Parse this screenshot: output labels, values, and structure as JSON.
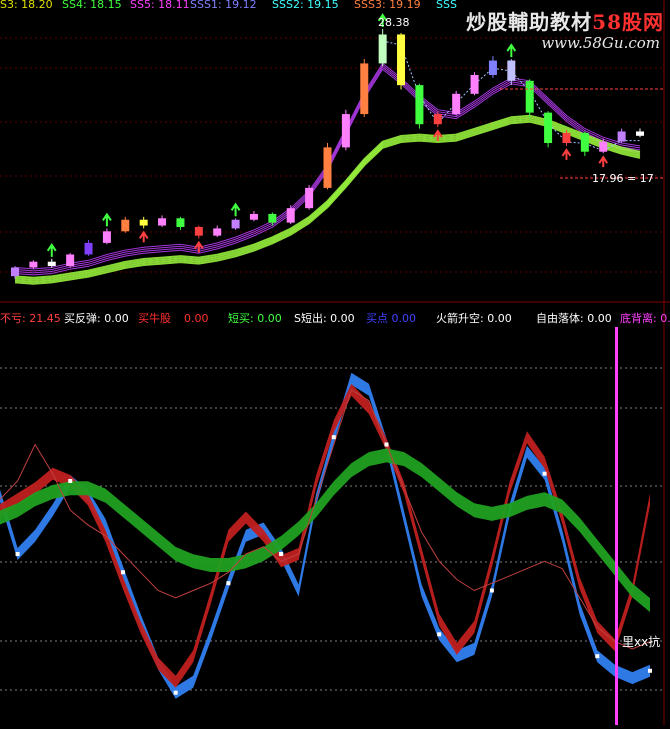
{
  "watermark": {
    "title_main": "炒股輔助教材",
    "title_red": "58股网",
    "url": "www.58Gu.com"
  },
  "top_legend": [
    {
      "text": "S3: 18.20",
      "color": "#e0e000"
    },
    {
      "text": "SS4: 18.15",
      "color": "#40ff40"
    },
    {
      "text": "SS5: 18.11",
      "color": "#ff40ff"
    },
    {
      "text": "SSS1: 19.12",
      "color": "#8080ff"
    },
    {
      "text": "SSS2: 19.15",
      "color": "#40ffff"
    },
    {
      "text": "SSS3: 19.19",
      "color": "#ff8040"
    },
    {
      "text": "SSS",
      "color": "#40ffff"
    }
  ],
  "annotations": {
    "peak_price": "28.38",
    "current_price": "17.96",
    "current_price_tail": "17",
    "bottom_marker": "里xx抗"
  },
  "indicator_legend": [
    {
      "text": "不亏: 21.45",
      "color": "#ff4040"
    },
    {
      "text": "买反弹: 0.00",
      "color": "#ffffff"
    },
    {
      "text": "买牛股",
      "color": "#ff3030"
    },
    {
      "text": "0.00",
      "color": "#ff3030"
    },
    {
      "text": "短买: 0.00",
      "color": "#40ff40"
    },
    {
      "text": "S短出: 0.00",
      "color": "#ffffff"
    },
    {
      "text": "买点 0.00",
      "color": "#4040ff"
    },
    {
      "text": "火箭升空: 0.00",
      "color": "#ffffff"
    },
    {
      "text": "自由落体: 0.00",
      "color": "#ffffff"
    },
    {
      "text": "底背离: 0.00",
      "color": "#ff40ff"
    }
  ],
  "chart_data": [
    {
      "type": "candlestick",
      "title": "",
      "series": [
        {
          "name": "SS5",
          "values": [
            11.9,
            11.8,
            11.9,
            12.2,
            12.4,
            12.8,
            13.1,
            13.3,
            13.4,
            13.5,
            13.3,
            13.6,
            14.0,
            14.5,
            15.1,
            16.0,
            17.2,
            19.0,
            21.5,
            24.0,
            26.0,
            25.0,
            23.8,
            22.8,
            22.6,
            23.4,
            24.3,
            25.0,
            24.8,
            23.6,
            22.4,
            21.5,
            20.9,
            20.5,
            20.3
          ]
        },
        {
          "name": "SSS1",
          "values": [
            11.7,
            11.6,
            11.7,
            11.9,
            12.1,
            12.4,
            12.7,
            12.9,
            13.0,
            13.1,
            13.0,
            13.2,
            13.5,
            13.9,
            14.4,
            15.0,
            15.8,
            16.9,
            18.3,
            19.8,
            21.0,
            21.4,
            21.5,
            21.4,
            21.5,
            21.9,
            22.3,
            22.7,
            22.8,
            22.5,
            22.0,
            21.5,
            21.0,
            20.6,
            20.3
          ]
        }
      ],
      "labels": {
        "peak": "28.38",
        "last": "17.96"
      },
      "candles": [
        {
          "c": "#c080ff",
          "o": 11.3,
          "cl": 11.9,
          "h": 12.0,
          "l": 11.1
        },
        {
          "c": "#ff80ff",
          "o": 11.9,
          "cl": 12.3,
          "h": 12.4,
          "l": 11.8
        },
        {
          "c": "#ffffff",
          "o": 12.3,
          "cl": 12.0,
          "h": 12.5,
          "l": 11.9
        },
        {
          "c": "#ff80ff",
          "o": 12.0,
          "cl": 12.8,
          "h": 12.9,
          "l": 11.9
        },
        {
          "c": "#8040ff",
          "o": 12.8,
          "cl": 13.6,
          "h": 13.8,
          "l": 12.7
        },
        {
          "c": "#ff80ff",
          "o": 13.6,
          "cl": 14.4,
          "h": 14.6,
          "l": 13.5
        },
        {
          "c": "#ff8040",
          "o": 14.4,
          "cl": 15.2,
          "h": 15.4,
          "l": 14.3
        },
        {
          "c": "#ffff40",
          "o": 15.2,
          "cl": 14.8,
          "h": 15.4,
          "l": 14.6
        },
        {
          "c": "#ff80ff",
          "o": 14.8,
          "cl": 15.3,
          "h": 15.5,
          "l": 14.7
        },
        {
          "c": "#40ff40",
          "o": 15.3,
          "cl": 14.7,
          "h": 15.4,
          "l": 14.5
        },
        {
          "c": "#ff4040",
          "o": 14.7,
          "cl": 14.1,
          "h": 14.8,
          "l": 13.9
        },
        {
          "c": "#ff80ff",
          "o": 14.1,
          "cl": 14.6,
          "h": 14.8,
          "l": 14.0
        },
        {
          "c": "#c080ff",
          "o": 14.6,
          "cl": 15.2,
          "h": 15.3,
          "l": 14.5
        },
        {
          "c": "#ff80ff",
          "o": 15.2,
          "cl": 15.6,
          "h": 15.8,
          "l": 15.1
        },
        {
          "c": "#40ff40",
          "o": 15.6,
          "cl": 15.0,
          "h": 15.7,
          "l": 14.8
        },
        {
          "c": "#ff80ff",
          "o": 15.0,
          "cl": 16.0,
          "h": 16.2,
          "l": 14.9
        },
        {
          "c": "#ff80ff",
          "o": 16.0,
          "cl": 17.4,
          "h": 17.6,
          "l": 15.9
        },
        {
          "c": "#ff8040",
          "o": 17.4,
          "cl": 20.2,
          "h": 20.5,
          "l": 17.3
        },
        {
          "c": "#ff80ff",
          "o": 20.2,
          "cl": 22.5,
          "h": 22.8,
          "l": 20.0
        },
        {
          "c": "#ff8040",
          "o": 22.5,
          "cl": 26.0,
          "h": 26.3,
          "l": 22.3
        },
        {
          "c": "#c0ffc0",
          "o": 26.0,
          "cl": 28.0,
          "h": 28.38,
          "l": 25.8
        },
        {
          "c": "#ffff40",
          "o": 28.0,
          "cl": 24.5,
          "h": 28.1,
          "l": 24.2
        },
        {
          "c": "#40ff40",
          "o": 24.5,
          "cl": 21.8,
          "h": 24.6,
          "l": 21.5
        },
        {
          "c": "#ff4040",
          "o": 21.8,
          "cl": 22.5,
          "h": 22.7,
          "l": 21.6
        },
        {
          "c": "#ff80ff",
          "o": 22.5,
          "cl": 23.9,
          "h": 24.1,
          "l": 22.4
        },
        {
          "c": "#ff80ff",
          "o": 23.9,
          "cl": 25.2,
          "h": 25.4,
          "l": 23.8
        },
        {
          "c": "#8080ff",
          "o": 25.2,
          "cl": 26.2,
          "h": 26.5,
          "l": 25.0
        },
        {
          "c": "#c0c0ff",
          "o": 26.2,
          "cl": 24.8,
          "h": 26.3,
          "l": 24.5
        },
        {
          "c": "#40ff40",
          "o": 24.8,
          "cl": 22.6,
          "h": 24.9,
          "l": 22.3
        },
        {
          "c": "#40ff40",
          "o": 22.6,
          "cl": 20.5,
          "h": 22.7,
          "l": 20.2
        },
        {
          "c": "#ff4040",
          "o": 20.5,
          "cl": 21.2,
          "h": 21.4,
          "l": 20.3
        },
        {
          "c": "#40ff40",
          "o": 21.2,
          "cl": 19.9,
          "h": 21.3,
          "l": 19.6
        },
        {
          "c": "#ff80ff",
          "o": 19.9,
          "cl": 20.6,
          "h": 20.8,
          "l": 19.8
        },
        {
          "c": "#c080ff",
          "o": 20.6,
          "cl": 21.3,
          "h": 21.5,
          "l": 20.5
        },
        {
          "c": "#ffffff",
          "o": 21.3,
          "cl": 21.0,
          "h": 21.5,
          "l": 20.9
        }
      ]
    },
    {
      "type": "line",
      "title": "",
      "series": [
        {
          "name": "blue",
          "values": [
            56,
            40,
            45,
            52,
            60,
            56,
            48,
            35,
            22,
            10,
            2,
            5,
            18,
            32,
            45,
            47,
            40,
            30,
            55,
            72,
            88,
            85,
            70,
            50,
            30,
            18,
            12,
            14,
            30,
            52,
            68,
            62,
            45,
            25,
            12,
            8,
            6,
            8
          ]
        },
        {
          "name": "red",
          "values": [
            52,
            55,
            58,
            62,
            60,
            55,
            45,
            32,
            20,
            10,
            5,
            12,
            28,
            45,
            50,
            45,
            38,
            40,
            60,
            75,
            85,
            80,
            70,
            58,
            40,
            22,
            14,
            20,
            38,
            58,
            72,
            65,
            50,
            32,
            20,
            15,
            30,
            55
          ]
        },
        {
          "name": "green",
          "values": [
            50,
            52,
            55,
            57,
            58,
            58,
            56,
            52,
            48,
            44,
            40,
            38,
            37,
            37,
            38,
            40,
            43,
            47,
            52,
            58,
            63,
            66,
            67,
            66,
            63,
            59,
            55,
            52,
            51,
            52,
            54,
            55,
            53,
            48,
            42,
            36,
            30,
            26
          ]
        },
        {
          "name": "thin",
          "values": [
            55,
            60,
            70,
            62,
            52,
            48,
            45,
            40,
            35,
            30,
            28,
            30,
            32,
            35,
            40,
            42,
            38,
            40,
            55,
            70,
            85,
            82,
            70,
            58,
            46,
            38,
            33,
            30,
            32,
            34,
            36,
            38,
            36,
            28,
            20,
            16,
            14,
            16
          ]
        }
      ]
    }
  ]
}
